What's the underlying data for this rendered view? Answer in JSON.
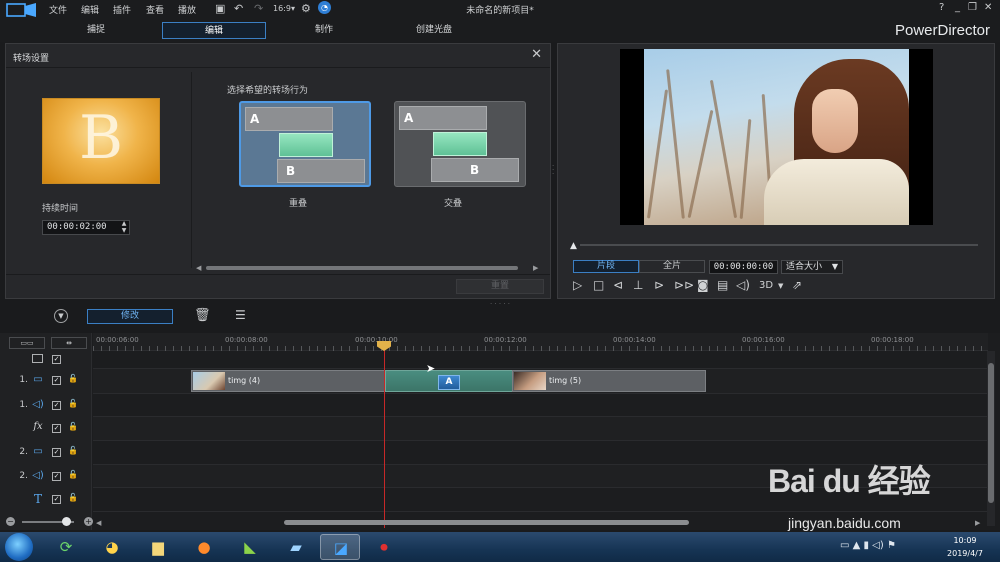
{
  "titlebar": {
    "menus": [
      "文件",
      "编辑",
      "插件",
      "查看",
      "播放"
    ],
    "window_title": "未命名的新项目*",
    "help": "?"
  },
  "tabs": [
    "捕捉",
    "编辑",
    "制作",
    "创建光盘"
  ],
  "active_tab": "编辑",
  "brand": "PowerDirector",
  "transition_panel": {
    "title": "转场设置",
    "thumbnail_letter": "B",
    "duration_label": "持续时间",
    "duration_value": "00:00:02:00",
    "behavior_label": "选择希望的转场行为",
    "options": [
      {
        "label": "重叠",
        "selected": true
      },
      {
        "label": "交叠",
        "selected": false
      }
    ],
    "reset_label": "重置"
  },
  "preview": {
    "mode_clip": "片段",
    "mode_full": "全片",
    "timecode": "00:00:00:00",
    "fit": "适合大小",
    "three_d": "3D"
  },
  "toolbar": {
    "modify_label": "修改"
  },
  "timeline": {
    "ruler_labels": [
      "00:00:06:00",
      "00:00:08:00",
      "00:00:10:00",
      "00:00:12:00",
      "00:00:14:00",
      "00:00:16:00",
      "00:00:18:00"
    ],
    "tracks": [
      {
        "num": "",
        "icon": "track-select-icon"
      },
      {
        "num": "1.",
        "icon": "video-track-icon"
      },
      {
        "num": "1.",
        "icon": "audio-track-icon"
      },
      {
        "num": "",
        "icon": "fx-track-icon",
        "glyph": "fx"
      },
      {
        "num": "2.",
        "icon": "video-track-icon"
      },
      {
        "num": "2.",
        "icon": "audio-track-icon"
      },
      {
        "num": "",
        "icon": "title-track-icon",
        "glyph": "T"
      }
    ],
    "clip1_label": "timg (4)",
    "clip2_label": "timg (5)",
    "transition_glyph": "A"
  },
  "taskbar": {
    "time": "10:09",
    "date": "2019/4/7"
  },
  "watermark": {
    "logo": "Bai du 经验",
    "url": "jingyan.baidu.com"
  },
  "colors": {
    "accent": "#3b7fc4",
    "playhead": "#c62828",
    "transition_clip": "#3c7568"
  }
}
